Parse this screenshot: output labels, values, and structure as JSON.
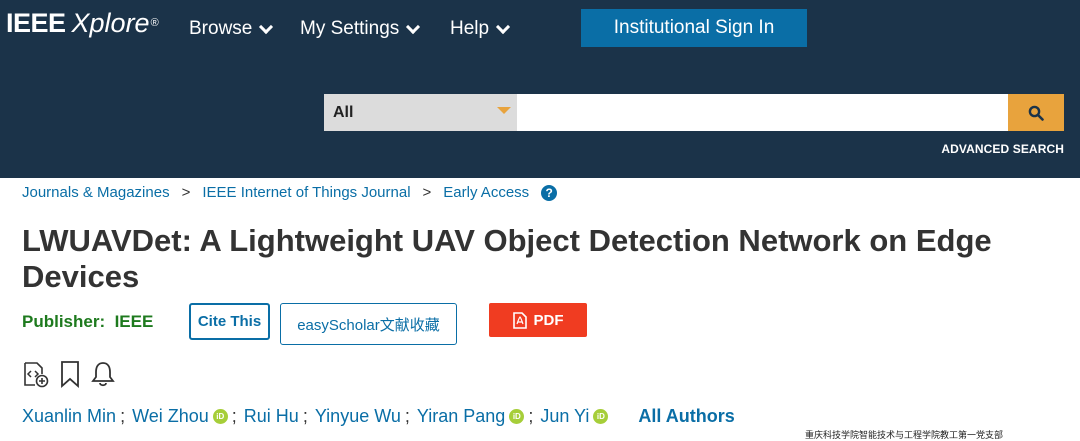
{
  "header": {
    "logo_ieee": "IEEE",
    "logo_xplore": "Xplore",
    "logo_reg": "®",
    "nav": [
      {
        "label": "Browse"
      },
      {
        "label": "My Settings"
      },
      {
        "label": "Help"
      }
    ],
    "signin_label": "Institutional Sign In"
  },
  "search": {
    "scope": "All",
    "value": "",
    "advanced_label": "ADVANCED SEARCH",
    "icon": "search-icon"
  },
  "breadcrumb": {
    "items": [
      "Journals & Magazines",
      "IEEE Internet of Things Journal",
      "Early Access"
    ],
    "separator": ">",
    "help_glyph": "?"
  },
  "article": {
    "title": "LWUAVDet: A Lightweight UAV Object Detection Network on Edge Devices",
    "publisher_label": "Publisher:",
    "publisher_name": "IEEE",
    "cite_label": "Cite This",
    "easyscholar_label": "easyScholar文献收藏",
    "pdf_label": "PDF",
    "icons": [
      "code-plus-icon",
      "bookmark-icon",
      "bell-icon"
    ]
  },
  "authors": {
    "list": [
      {
        "name": "Xuanlin Min",
        "orcid": false
      },
      {
        "name": "Wei Zhou",
        "orcid": true
      },
      {
        "name": "Rui Hu",
        "orcid": false
      },
      {
        "name": "Yinyue Wu",
        "orcid": false
      },
      {
        "name": "Yiran Pang",
        "orcid": true
      },
      {
        "name": "Jun Yi",
        "orcid": true
      }
    ],
    "separator": ";",
    "orcid_glyph": "iD",
    "all_authors_label": "All Authors"
  },
  "watermark": "重庆科技学院智能技术与工程学院教工第一党支部",
  "colors": {
    "header_bg": "#1b3349",
    "accent_blue": "#0a6ea6",
    "search_orange": "#e8a33d",
    "pdf_red": "#f03c21",
    "publisher_green": "#1e7a1e",
    "orcid_green": "#a6ce39"
  }
}
